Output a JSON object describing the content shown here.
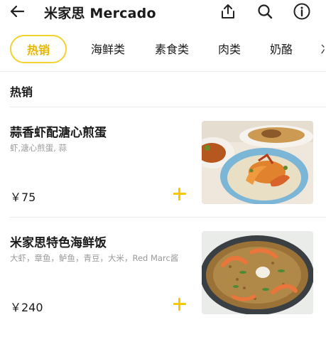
{
  "header": {
    "title": "米家思 Mercado",
    "icons": [
      "back-arrow-icon",
      "share-icon",
      "search-icon",
      "info-icon"
    ]
  },
  "tabs": [
    {
      "label": "热销",
      "active": true
    },
    {
      "label": "海鲜类"
    },
    {
      "label": "素食类"
    },
    {
      "label": "肉类"
    },
    {
      "label": "奶酪"
    },
    {
      "label": "冫"
    }
  ],
  "section": {
    "title": "热销"
  },
  "items": [
    {
      "name": "蒜香虾配溏心煎蛋",
      "desc": "虾,溏心煎蛋, 蒜",
      "price": "￥75"
    },
    {
      "name": "米家思特色海鲜饭",
      "desc": "大虾，章鱼，鲈鱼，青豆，大米，Red Marc酱",
      "price": "￥240"
    }
  ],
  "colors": {
    "accent": "#f2d22e",
    "accent_text": "#e8b800",
    "plus": "#f5c800"
  }
}
